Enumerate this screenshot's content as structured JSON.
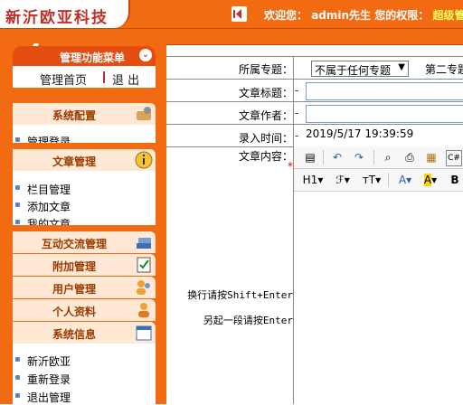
{
  "header": {
    "logo": "新沂欧亚科技",
    "welcome_prefix": "欢迎您：",
    "user": "admin先生",
    "perm_label": "您的权限：",
    "perm_value": "超级管"
  },
  "sidebar": {
    "title": "管理功能菜单",
    "home": "管理首页",
    "logout": "退 出",
    "sections": [
      {
        "title": "系统配置",
        "items": [
          "管理登录"
        ]
      },
      {
        "title": "文章管理",
        "items": [
          "栏目管理",
          "添加文章",
          "我的文章"
        ]
      },
      {
        "title": "互动交流管理",
        "items": []
      },
      {
        "title": "附加管理",
        "items": []
      },
      {
        "title": "用户管理",
        "items": []
      },
      {
        "title": "个人资料",
        "items": []
      },
      {
        "title": "系统信息",
        "items": [
          "新沂欧亚",
          "重新登录",
          "退出管理"
        ]
      }
    ]
  },
  "form": {
    "topic_label": "所属专题：",
    "topic_value": "不属于任何专题",
    "second_topic": "第二专题",
    "title_label": "文章标题：",
    "author_label": "文章作者：",
    "time_label": "录入时间：",
    "time_value": "2019/5/17 19:39:59",
    "content_label": "文章内容：",
    "required_mark": "*",
    "hint_line": "换行请按Shift+Enter",
    "hint_para": "另起一段请按Enter"
  },
  "editor": {
    "heading_btn": "H1",
    "font_btn": "ℱ",
    "size_btn": "тT",
    "color_btn": "A",
    "bg_btn": "A",
    "bold_btn": "B"
  }
}
